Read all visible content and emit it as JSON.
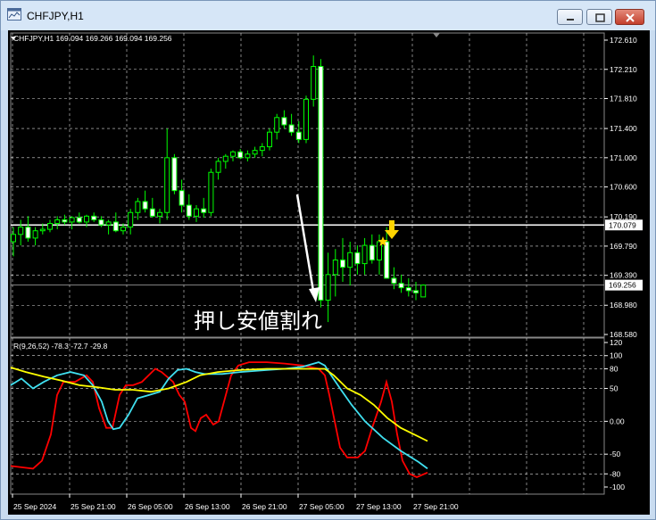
{
  "window": {
    "title": "CHFJPY,H1"
  },
  "chart_header": {
    "symbol_info": "CHFJPY,H1  169.094 169.266 169.094 169.256"
  },
  "price_axis": {
    "ticks": [
      "172.610",
      "172.210",
      "171.810",
      "171.400",
      "171.000",
      "170.600",
      "170.190",
      "169.790",
      "169.390",
      "168.980",
      "168.580"
    ],
    "level_tags": [
      "170.079",
      "169.256"
    ]
  },
  "overlay": {
    "annotation_text": "押し安値割れ"
  },
  "indicator": {
    "header": "R(9,26,52) -78.3 -72.7 -29.8",
    "ticks": [
      "120",
      "100",
      "80",
      "50",
      "0.00",
      "-50",
      "-80",
      "-100"
    ]
  },
  "time_axis": {
    "labels": [
      "25 Sep 2024",
      "25 Sep 21:00",
      "26 Sep 05:00",
      "26 Sep 13:00",
      "26 Sep 21:00",
      "27 Sep 05:00",
      "27 Sep 13:00",
      "27 Sep 21:00"
    ]
  },
  "colors": {
    "background": "#000000",
    "candle": "#00ff00",
    "line_red": "#ff0000",
    "line_cyan": "#40e0f0",
    "line_yellow": "#ffff00",
    "grid": "#ffffff"
  },
  "chart_data": [
    {
      "type": "candlestick",
      "title": "CHFJPY,H1",
      "ylim": [
        168.58,
        172.61
      ],
      "x_labels": [
        "25 Sep 2024",
        "25 Sep 21:00",
        "26 Sep 05:00",
        "26 Sep 13:00",
        "26 Sep 21:00",
        "27 Sep 05:00",
        "27 Sep 13:00",
        "27 Sep 21:00"
      ],
      "ohlc_last": {
        "open": 169.094,
        "high": 169.266,
        "low": 169.094,
        "close": 169.256
      },
      "candles": [
        [
          169.85,
          170.05,
          169.65,
          169.95
        ],
        [
          169.95,
          170.15,
          169.8,
          170.05
        ],
        [
          170.05,
          170.2,
          169.85,
          169.9
        ],
        [
          169.9,
          170.05,
          169.8,
          170.0
        ],
        [
          170.0,
          170.1,
          169.95,
          170.02
        ],
        [
          170.02,
          170.15,
          169.98,
          170.1
        ],
        [
          170.1,
          170.2,
          170.02,
          170.15
        ],
        [
          170.15,
          170.22,
          170.08,
          170.12
        ],
        [
          170.12,
          170.2,
          170.02,
          170.18
        ],
        [
          170.18,
          170.25,
          170.1,
          170.12
        ],
        [
          170.12,
          170.22,
          170.05,
          170.2
        ],
        [
          170.2,
          170.25,
          170.12,
          170.15
        ],
        [
          170.15,
          170.2,
          170.05,
          170.08
        ],
        [
          170.08,
          170.15,
          169.95,
          170.12
        ],
        [
          170.12,
          170.25,
          169.98,
          170.0
        ],
        [
          170.0,
          170.1,
          169.95,
          170.05
        ],
        [
          170.05,
          170.3,
          169.95,
          170.25
        ],
        [
          170.25,
          170.45,
          170.15,
          170.4
        ],
        [
          170.4,
          170.55,
          170.25,
          170.3
        ],
        [
          170.3,
          170.45,
          170.18,
          170.2
        ],
        [
          170.2,
          170.3,
          170.1,
          170.25
        ],
        [
          170.25,
          171.4,
          170.15,
          171.0
        ],
        [
          171.0,
          171.05,
          170.5,
          170.55
        ],
        [
          170.55,
          170.7,
          170.25,
          170.35
        ],
        [
          170.35,
          170.5,
          170.15,
          170.2
        ],
        [
          170.2,
          170.35,
          170.12,
          170.3
        ],
        [
          170.3,
          170.45,
          170.18,
          170.25
        ],
        [
          170.25,
          170.85,
          170.2,
          170.8
        ],
        [
          170.8,
          171.0,
          170.7,
          170.95
        ],
        [
          170.95,
          171.05,
          170.85,
          171.02
        ],
        [
          171.02,
          171.1,
          170.95,
          171.08
        ],
        [
          171.08,
          171.12,
          170.98,
          171.0
        ],
        [
          171.0,
          171.1,
          170.95,
          171.05
        ],
        [
          171.05,
          171.15,
          171.0,
          171.1
        ],
        [
          171.1,
          171.2,
          171.02,
          171.15
        ],
        [
          171.15,
          171.4,
          171.1,
          171.35
        ],
        [
          171.35,
          171.6,
          171.25,
          171.55
        ],
        [
          171.55,
          171.65,
          171.4,
          171.45
        ],
        [
          171.45,
          171.6,
          171.3,
          171.35
        ],
        [
          171.35,
          171.5,
          171.2,
          171.25
        ],
        [
          171.25,
          171.85,
          171.2,
          171.8
        ],
        [
          171.8,
          172.4,
          171.7,
          172.25
        ],
        [
          172.25,
          172.35,
          168.95,
          169.05
        ],
        [
          169.05,
          169.7,
          168.75,
          169.4
        ],
        [
          169.4,
          169.75,
          169.1,
          169.6
        ],
        [
          169.6,
          169.9,
          169.3,
          169.5
        ],
        [
          169.5,
          169.85,
          169.25,
          169.7
        ],
        [
          169.7,
          169.8,
          169.4,
          169.55
        ],
        [
          169.55,
          169.9,
          169.4,
          169.8
        ],
        [
          169.8,
          169.95,
          169.55,
          169.6
        ],
        [
          169.6,
          169.95,
          169.4,
          169.85
        ],
        [
          169.85,
          170.05,
          169.6,
          169.35
        ],
        [
          169.35,
          169.5,
          169.2,
          169.28
        ],
        [
          169.28,
          169.4,
          169.15,
          169.22
        ],
        [
          169.22,
          169.35,
          169.1,
          169.18
        ],
        [
          169.18,
          169.3,
          169.05,
          169.15
        ],
        [
          169.094,
          169.266,
          169.094,
          169.256
        ]
      ]
    },
    {
      "type": "line",
      "title": "R(9,26,52)",
      "ylim": [
        -100,
        120
      ],
      "series": [
        {
          "name": "R(9)",
          "color": "#ff0000",
          "last": -78.3
        },
        {
          "name": "R(26)",
          "color": "#40e0f0",
          "last": -72.7
        },
        {
          "name": "R(52)",
          "color": "#ffff00",
          "last": -29.8
        }
      ]
    }
  ]
}
